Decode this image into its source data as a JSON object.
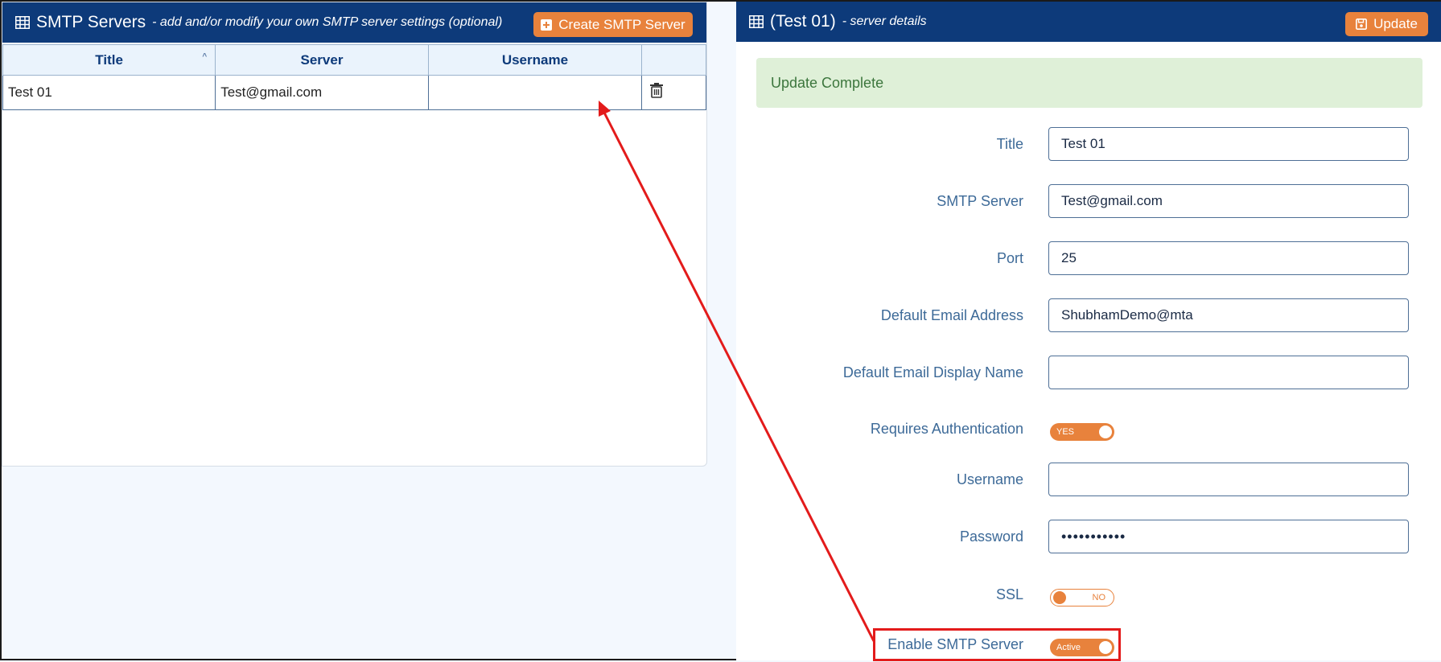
{
  "left": {
    "title": "SMTP Servers",
    "subtitle": "- add and/or modify your own SMTP server settings (optional)",
    "create_button": "Create SMTP Server",
    "columns": [
      "Title",
      "Server",
      "Username"
    ],
    "rows": [
      {
        "title": "Test 01",
        "server": "Test@gmail.com",
        "username": ""
      }
    ]
  },
  "right": {
    "title": "(Test 01)",
    "subtitle": "- server details",
    "update_button": "Update",
    "alert": "Update Complete",
    "fields": {
      "title": {
        "label": "Title",
        "value": "Test 01"
      },
      "smtp_server": {
        "label": "SMTP Server",
        "value": "Test@gmail.com"
      },
      "port": {
        "label": "Port",
        "value": "25"
      },
      "default_email": {
        "label": "Default Email Address",
        "value": "ShubhamDemo@mta"
      },
      "display_name": {
        "label": "Default Email Display Name",
        "value": ""
      },
      "requires_auth": {
        "label": "Requires Authentication",
        "state": "YES"
      },
      "username": {
        "label": "Username",
        "value": ""
      },
      "password": {
        "label": "Password",
        "value": "•••••••••••"
      },
      "ssl": {
        "label": "SSL",
        "state": "NO"
      },
      "enable": {
        "label": "Enable SMTP Server",
        "state": "Active"
      }
    }
  },
  "colors": {
    "header": "#0d3a7a",
    "accent": "#e8823c",
    "alert_bg": "#dff0d8",
    "annotation": "#e31b1b"
  },
  "icons": [
    "table-icon",
    "plus-square-icon",
    "trash-icon",
    "save-icon",
    "sort-caret-icon"
  ]
}
